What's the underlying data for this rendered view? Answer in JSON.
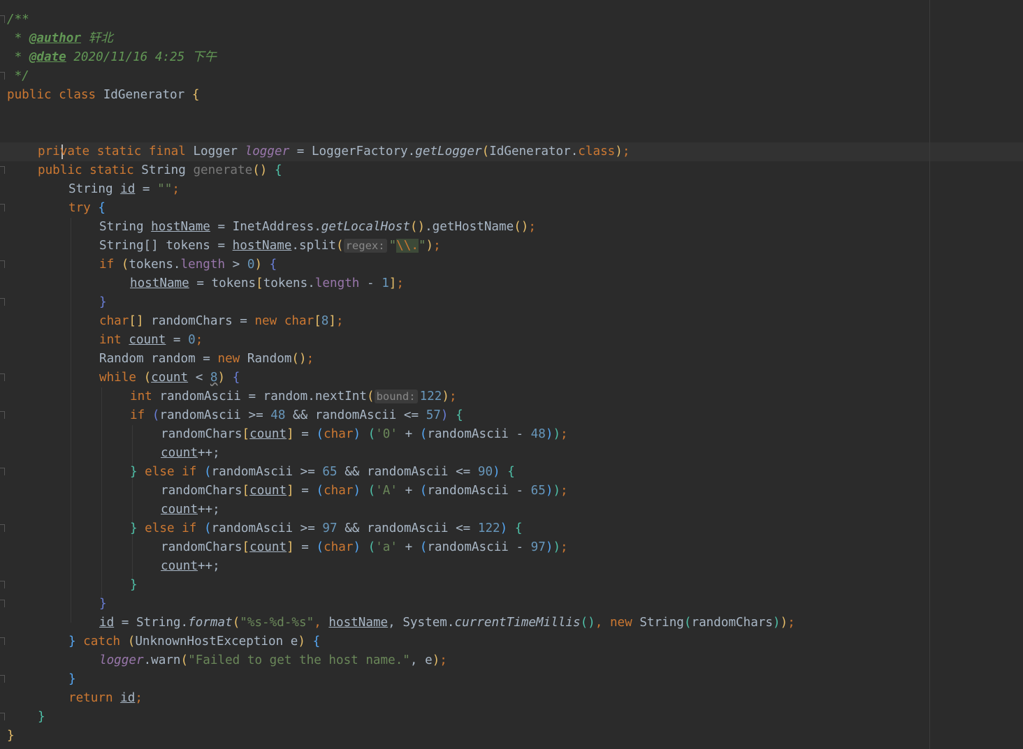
{
  "editor": {
    "language": "java",
    "caret_line": 8,
    "colors": {
      "background": "#2b2b2b",
      "keyword": "#cc7832",
      "comment": "#629755",
      "string": "#6a8759",
      "number": "#6897bb",
      "field": "#9876aa",
      "text": "#a9b7c6"
    },
    "doc": {
      "open": "/**",
      "author_prefix": " * ",
      "author_tag": "@author",
      "author_value": " 轩北",
      "date_prefix": " * ",
      "date_tag": "@date",
      "date_value": " 2020/11/16 4:25 下午",
      "close": " */"
    },
    "class_decl": {
      "kw": "public class",
      "name": " IdGenerator ",
      "brace": "{"
    },
    "hints": {
      "regex": "regex:",
      "bound": "bound:"
    },
    "code": {
      "l8_kw": "private static final",
      "l8_type": " Logger ",
      "l8_field": "logger",
      "l8_rest": " = LoggerFactory.",
      "l8_method": "getLogger",
      "l8_arg": "IdGenerator.",
      "l8_classkw": "class",
      "l8_end": ";",
      "l9_kw": "public static",
      "l9_type": " String ",
      "l9_name": "generate",
      "l9_parens": "()",
      "l10_type": "String ",
      "l10_var": "id",
      "l10_eq": " = ",
      "l10_str": "\"\"",
      "l10_end": ";",
      "l11_kw": "try",
      "l12_type": "String ",
      "l12_var": "hostName",
      "l12_rest": " = InetAddress.",
      "l12_method": "getLocalHost",
      "l12_rest2": ".getHostName",
      "l12_end": ";",
      "l13_type": "String[] tokens = ",
      "l13_var": "hostName",
      "l13_split": ".split",
      "l13_str_q1": "\"",
      "l13_esc": "\\\\.",
      "l13_str_q2": "\"",
      "l13_end": ";",
      "l14_kw": "if",
      "l14_a": "tokens.",
      "l14_len": "length",
      "l14_gt": " > ",
      "l14_zero": "0",
      "l15_var": "hostName",
      "l15_a": " = tokens",
      "l15_b": "tokens.",
      "l15_len": "length",
      "l15_minus": " - ",
      "l15_one": "1",
      "l15_end": ";",
      "l17_kw": "char",
      "l17_a": " randomChars = ",
      "l17_new": "new",
      "l17_char": " char",
      "l17_eight": "8",
      "l17_end": ";",
      "l18_kw": "int",
      "l18_var": "count",
      "l18_eq": " = ",
      "l18_zero": "0",
      "l18_end": ";",
      "l19_a": "Random random = ",
      "l19_new": "new",
      "l19_b": " Random",
      "l19_end": ";",
      "l20_kw": "while",
      "l20_var": "count",
      "l20_lt": " < ",
      "l20_eight": "8",
      "l21_kw": "int",
      "l21_a": " randomAscii = random.nextInt",
      "l21_num": "122",
      "l21_end": ";",
      "l22_kw": "if",
      "l22_a": "randomAscii >= ",
      "l22_n1": "48",
      "l22_b": " && randomAscii <= ",
      "l22_n2": "57",
      "l23_a": "randomChars",
      "l23_var": "count",
      "l23_eq": " = ",
      "l23_char": "char",
      "l23_chr": "'0'",
      "l23_plus": " + ",
      "l23_b": "randomAscii - ",
      "l23_n": "48",
      "l24_var": "count",
      "l24_inc": "++;",
      "l25_kw": " else if ",
      "l25_a": "randomAscii >= ",
      "l25_n1": "65",
      "l25_b": " && randomAscii <= ",
      "l25_n2": "90",
      "l26_chr": "'A'",
      "l26_n": "65",
      "l28_n1": "97",
      "l28_n2": "122",
      "l29_chr": "'a'",
      "l29_n": "97",
      "l33_var": "id",
      "l33_a": " = String.",
      "l33_method": "format",
      "l33_str": "\"%s-%d-%s\"",
      "l33_comma": ", ",
      "l33_var2": "hostName",
      "l33_b": ", System.",
      "l33_method2": "currentTimeMillis",
      "l33_new": "new",
      "l33_c": " String",
      "l33_d": "randomChars",
      "l33_end": ";",
      "l34_catch": " catch ",
      "l34_a": "UnknownHostException e",
      "l35_field": "logger",
      "l35_a": ".warn",
      "l35_str": "\"Failed to get the host name.\"",
      "l35_b": ", e",
      "l35_end": ";",
      "l37_kw": "return",
      "l37_var": "id",
      "l37_end": ";"
    }
  }
}
